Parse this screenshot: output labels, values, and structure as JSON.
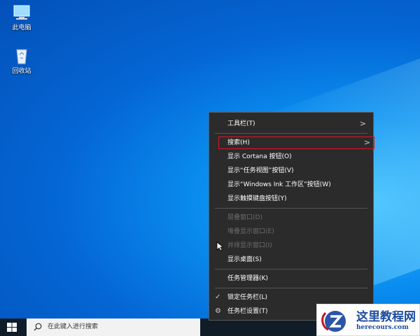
{
  "desktop": {
    "icons": [
      {
        "label": "此电脑"
      },
      {
        "label": "回收站"
      }
    ]
  },
  "menu": {
    "items": [
      {
        "label": "工具栏(T)",
        "submenu": true
      },
      {
        "label": "搜索(H)",
        "submenu": true,
        "highlighted": true
      },
      {
        "label": "显示 Cortana 按钮(O)"
      },
      {
        "label": "显示“任务视图”按钮(V)"
      },
      {
        "label": "显示“Windows Ink 工作区”按钮(W)"
      },
      {
        "label": "显示触摸键盘按钮(Y)"
      },
      {
        "label": "层叠窗口(D)",
        "disabled": true
      },
      {
        "label": "堆叠显示窗口(E)",
        "disabled": true
      },
      {
        "label": "并排显示窗口(I)",
        "disabled": true
      },
      {
        "label": "显示桌面(S)"
      },
      {
        "label": "任务管理器(K)"
      },
      {
        "label": "锁定任务栏(L)",
        "checked": true
      },
      {
        "label": "任务栏设置(T)",
        "icon": "gear-icon"
      }
    ]
  },
  "taskbar": {
    "search_placeholder": "在此键入进行搜索"
  },
  "watermark": {
    "title": "这里教程网",
    "url": "herecours.com"
  },
  "colors": {
    "highlight": "#e0161e",
    "menu_bg": "#2b2b2b"
  }
}
